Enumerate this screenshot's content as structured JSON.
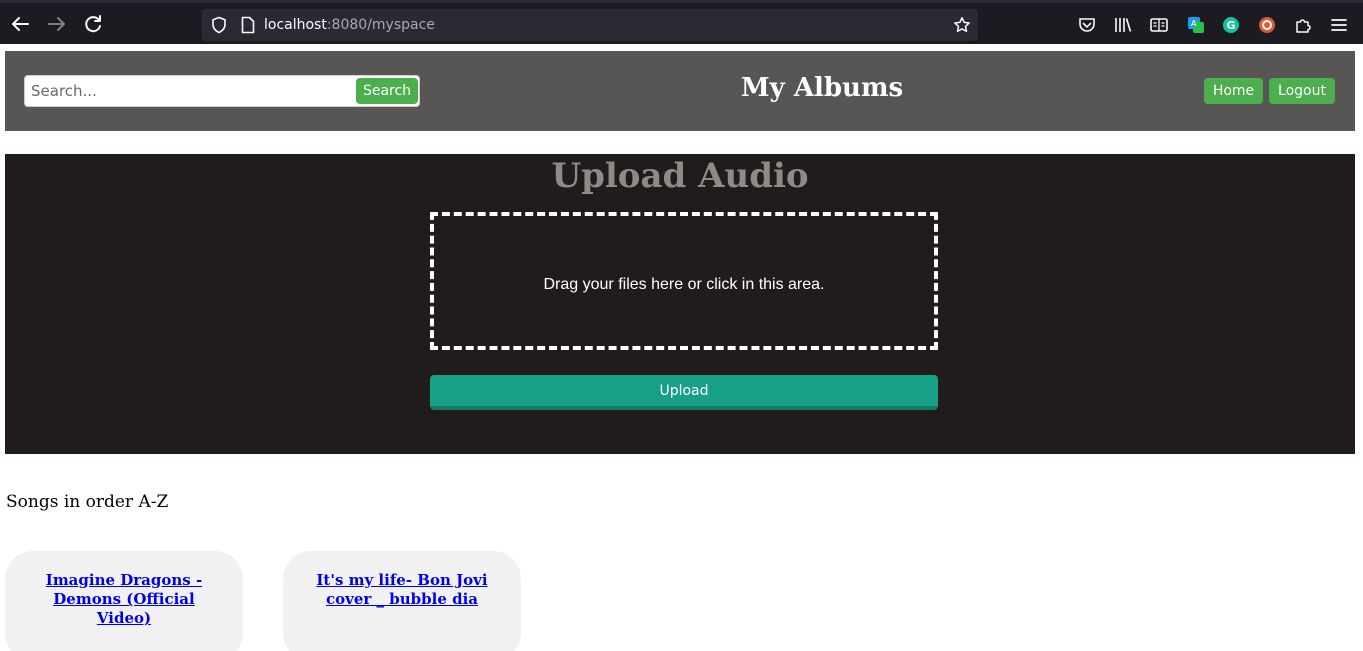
{
  "browser": {
    "url_host": "localhost",
    "url_rest": ":8080/myspace",
    "icons": [
      "back-arrow-icon",
      "forward-arrow-icon",
      "reload-icon",
      "shield-icon",
      "page-icon",
      "star-icon",
      "pocket-icon",
      "library-icon",
      "reader-view-icon",
      "extension-translate-icon",
      "grammarly-icon",
      "duckduckgo-icon",
      "extensions-icon",
      "menu-icon"
    ]
  },
  "header": {
    "search_placeholder": "Search...",
    "search_button": "Search",
    "title": "My Albums",
    "home_button": "Home",
    "logout_button": "Logout"
  },
  "upload": {
    "heading": "Upload Audio",
    "drop_text": "Drag your files here or click in this area.",
    "upload_button": "Upload"
  },
  "songs": {
    "caption": "Songs in order A-Z",
    "items": [
      {
        "title": "Imagine Dragons - Demons (Official Video)"
      },
      {
        "title": "It's my life- Bon Jovi cover _ bubble dia"
      }
    ]
  },
  "colors": {
    "header_bg": "#575655",
    "upload_bg": "#201c1c",
    "green_button": "#4cae4c",
    "upload_button": "#16a085",
    "card_bg": "#f1f1f1",
    "link": "#0000ee"
  }
}
